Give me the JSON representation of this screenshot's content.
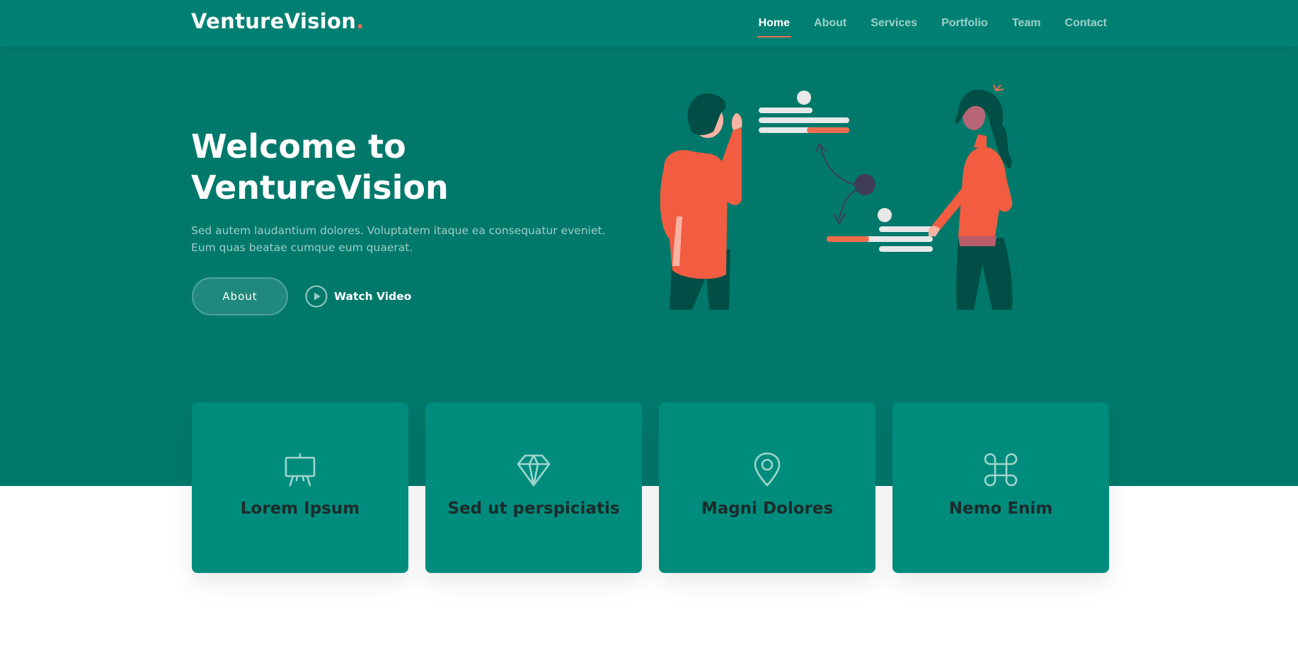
{
  "header": {
    "logo_text": "VentureVision",
    "logo_dot": ".",
    "nav": [
      {
        "label": "Home",
        "active": true
      },
      {
        "label": "About"
      },
      {
        "label": "Services"
      },
      {
        "label": "Portfolio"
      },
      {
        "label": "Team"
      },
      {
        "label": "Contact"
      }
    ]
  },
  "hero": {
    "title_line1": "Welcome to",
    "title_line2": "VentureVision",
    "subtitle": "Sed autem laudantium dolores. Voluptatem itaque ea consequatur eveniet. Eum quas beatae cumque eum quaerat.",
    "about_button": "About",
    "watch_video": "Watch Video"
  },
  "cards": [
    {
      "icon": "easel-icon",
      "title": "Lorem Ipsum"
    },
    {
      "icon": "gem-icon",
      "title": "Sed ut perspiciatis"
    },
    {
      "icon": "map-pin-icon",
      "title": "Magni Dolores"
    },
    {
      "icon": "command-icon",
      "title": "Nemo Enim"
    }
  ],
  "colors": {
    "hero_bg": "#00796b",
    "card_bg": "#008c7d",
    "accent": "#ef6c4d",
    "figure_dark": "#004e45",
    "text_dark": "#1d2b2a"
  }
}
